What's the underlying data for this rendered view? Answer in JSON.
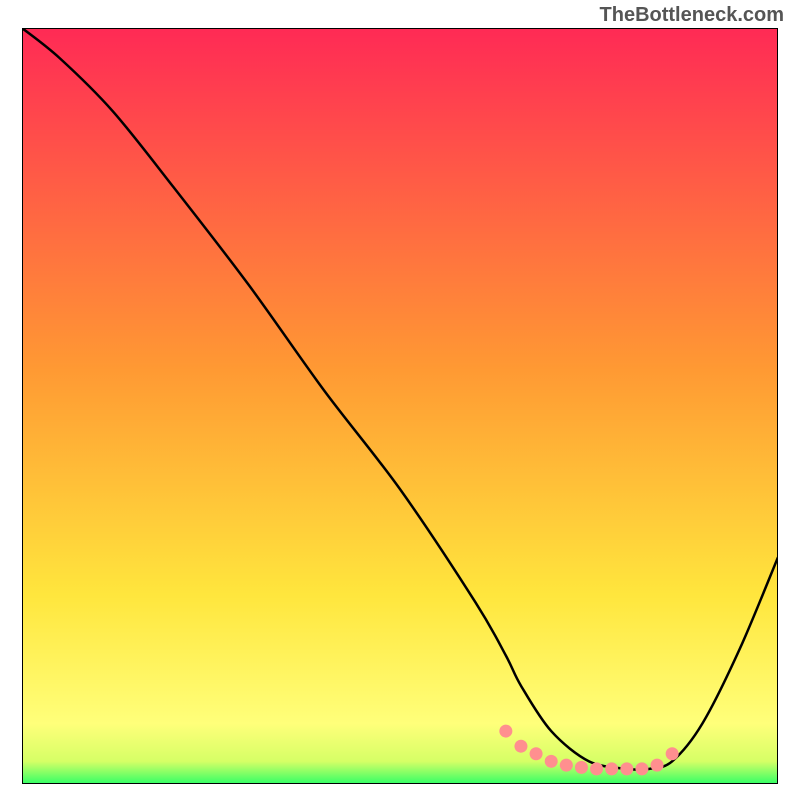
{
  "watermark": "TheBottleneck.com",
  "chart_data": {
    "type": "line",
    "title": "",
    "xlabel": "",
    "ylabel": "",
    "xlim": [
      0,
      100
    ],
    "ylim": [
      0,
      100
    ],
    "background_gradient": {
      "type": "vertical",
      "stops": [
        {
          "offset": 0,
          "color": "#ff2a55"
        },
        {
          "offset": 45,
          "color": "#ff9933"
        },
        {
          "offset": 75,
          "color": "#ffe63d"
        },
        {
          "offset": 92,
          "color": "#ffff7a"
        },
        {
          "offset": 97,
          "color": "#d6ff66"
        },
        {
          "offset": 100,
          "color": "#33ff66"
        }
      ]
    },
    "series": [
      {
        "name": "bottleneck-curve",
        "color": "#000000",
        "x": [
          0,
          5,
          12,
          20,
          30,
          40,
          50,
          60,
          64,
          66,
          70,
          75,
          80,
          83,
          86,
          90,
          95,
          100
        ],
        "values": [
          100,
          96,
          89,
          79,
          66,
          52,
          39,
          24,
          17,
          13,
          7,
          3,
          2,
          2,
          3,
          8,
          18,
          30
        ]
      }
    ],
    "markers": {
      "name": "optimal-range-markers",
      "color": "#ff8f8f",
      "x": [
        64,
        66,
        68,
        70,
        72,
        74,
        76,
        78,
        80,
        82,
        84,
        86
      ],
      "values": [
        7,
        5,
        4,
        3,
        2.5,
        2.2,
        2,
        2,
        2,
        2,
        2.5,
        4
      ]
    },
    "border": {
      "color": "#000000",
      "width": 2
    }
  }
}
